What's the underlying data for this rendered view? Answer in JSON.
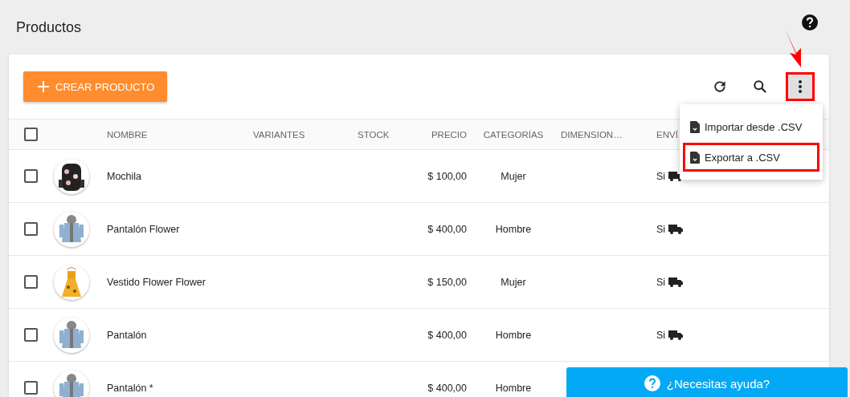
{
  "page": {
    "title": "Productos"
  },
  "toolbar": {
    "create_button": "CREAR PRODUCTO",
    "more_menu_open": true
  },
  "menu": [
    {
      "label": "Importar desde .CSV",
      "highlighted": false
    },
    {
      "label": "Exportar a .CSV",
      "highlighted": true
    }
  ],
  "table": {
    "select_all_checked": false,
    "columns": [
      "NOMBRE",
      "VARIANTES",
      "STOCK",
      "PRECIO",
      "CATEGORÍAS",
      "DIMENSION…",
      "ENVÍ"
    ],
    "rows": [
      {
        "checked": false,
        "name": "Mochila",
        "price": "$ 100,00",
        "category": "Mujer",
        "shipping": "Si"
      },
      {
        "checked": false,
        "name": "Pantalón Flower",
        "price": "$ 400,00",
        "category": "Hombre",
        "shipping": "Si"
      },
      {
        "checked": false,
        "name": "Vestido Flower Flower",
        "price": "$ 150,00",
        "category": "Mujer",
        "shipping": "Si"
      },
      {
        "checked": false,
        "name": "Pantalón",
        "price": "$ 400,00",
        "category": "Hombre",
        "shipping": "Si"
      },
      {
        "checked": false,
        "name": "Pantalón *",
        "price": "$ 400,00",
        "category": "Hombre"
      }
    ]
  },
  "help_bar": {
    "label": "¿Necesitas ayuda?"
  }
}
